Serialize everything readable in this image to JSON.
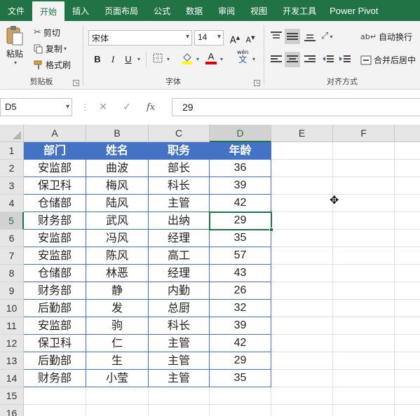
{
  "menu": {
    "tabs": [
      "文件",
      "开始",
      "插入",
      "页面布局",
      "公式",
      "数据",
      "审阅",
      "视图",
      "开发工具",
      "Power Pivot"
    ],
    "active_index": 1
  },
  "ribbon": {
    "clipboard": {
      "paste": "粘贴",
      "cut": "剪切",
      "copy": "复制",
      "format_painter": "格式刷",
      "label": "剪贴板"
    },
    "font": {
      "font_name": "宋体",
      "font_size": "14",
      "grow": "A",
      "shrink": "A",
      "bold": "B",
      "italic": "I",
      "underline": "U",
      "wen": "wén",
      "wen_char": "文",
      "label": "字体",
      "highlight_color": "#ffff00",
      "font_color": "#e00000"
    },
    "alignment": {
      "wrap_text": "自动换行",
      "merge_center": "合并后居中",
      "label": "对齐方式"
    }
  },
  "formula_bar": {
    "name_box": "D5",
    "cancel": "✕",
    "enter": "✓",
    "fx": "fx",
    "content": "29"
  },
  "sheet": {
    "columns": [
      "A",
      "B",
      "C",
      "D",
      "E",
      "F"
    ],
    "rows": [
      "1",
      "2",
      "3",
      "4",
      "5",
      "6",
      "7",
      "8",
      "9",
      "10",
      "11",
      "12",
      "13",
      "14",
      "15",
      "16"
    ],
    "selected_cell": "D5",
    "header": [
      "部门",
      "姓名",
      "职务",
      "年龄"
    ],
    "data": [
      [
        "安监部",
        "曲波",
        "部长",
        "36"
      ],
      [
        "保卫科",
        "梅风",
        "科长",
        "39"
      ],
      [
        "仓储部",
        "陆风",
        "主管",
        "42"
      ],
      [
        "财务部",
        "武风",
        "出纳",
        "29"
      ],
      [
        "安监部",
        "冯风",
        "经理",
        "35"
      ],
      [
        "安监部",
        "陈风",
        "高工",
        "57"
      ],
      [
        "仓储部",
        "林恶",
        "经理",
        "43"
      ],
      [
        "财务部",
        "静",
        "内勤",
        "26"
      ],
      [
        "后勤部",
        "发",
        "总厨",
        "32"
      ],
      [
        "安监部",
        "驹",
        "科长",
        "39"
      ],
      [
        "保卫科",
        "仁",
        "主管",
        "42"
      ],
      [
        "后勤部",
        "生",
        "主管",
        "29"
      ],
      [
        "财务部",
        "小莹",
        "主管",
        "35"
      ]
    ],
    "header_color": "#4472c4"
  }
}
